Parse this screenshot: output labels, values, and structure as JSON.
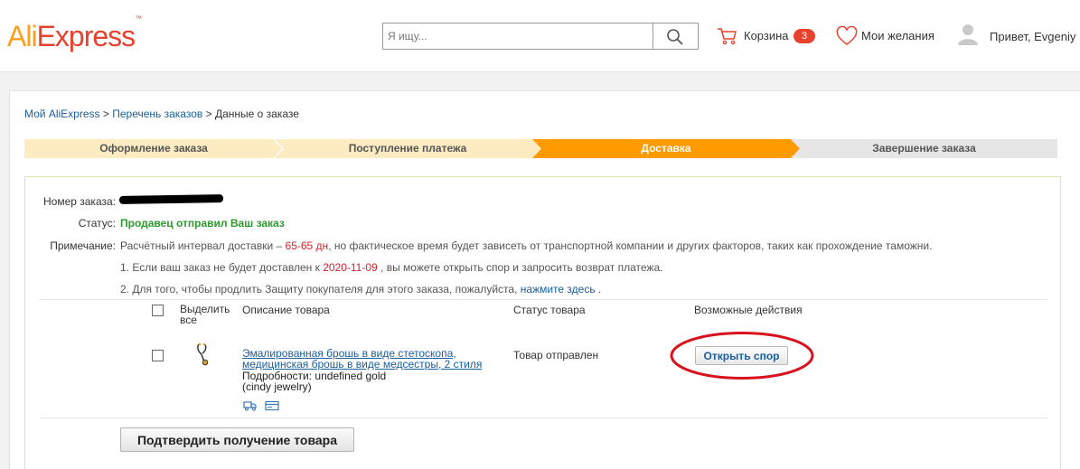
{
  "header": {
    "logo_part1": "Ali",
    "logo_part2": "Express",
    "logo_tm": "™",
    "search_placeholder": "Я ищу...",
    "search_icon": "search-icon",
    "cart_label": "Корзина",
    "cart_count": "3",
    "wishlist_label": "Мои желания",
    "greeting": "Привет, Evgeniy"
  },
  "breadcrumb": {
    "items": [
      "Мой AliExpress",
      "Перечень заказов",
      "Данные о заказе"
    ],
    "separator": ">"
  },
  "steps": [
    {
      "label": "Оформление заказа",
      "state": "done"
    },
    {
      "label": "Поступление платежа",
      "state": "done"
    },
    {
      "label": "Доставка",
      "state": "active"
    },
    {
      "label": "Завершение заказа",
      "state": "pending"
    }
  ],
  "colors": {
    "step_done": "#fdebc2",
    "step_active": "#ff9a00",
    "step_pending": "#e6e6e6",
    "status_green": "#2e9b2e",
    "accent_red": "#d0232b",
    "link_blue": "#1a5fa0",
    "annotation_red": "#d8121d"
  },
  "order": {
    "number_label": "Номер заказа:",
    "status_label": "Статус:",
    "status_value": "Продавец отправил Ваш заказ",
    "note_label": "Примечание:",
    "note_line1_before": "Расчётный интервал доставки – ",
    "note_line1_days": "65-65 дн",
    "note_line1_after": ", но фактическое время будет зависеть от транспортной компании и других факторов, таких как прохождение таможни.",
    "note_line2_before": "1. Если ваш заказ не будет доставлен к ",
    "note_line2_date": "2020-11-09",
    "note_line2_after": " , вы можете открыть спор и запросить возврат платежа.",
    "note_line3_before": "2. Для того, чтобы продлить Защиту покупателя для этого заказа, пожалуйста, ",
    "note_line3_link": "нажмите здесь",
    "note_line3_after": " ."
  },
  "table": {
    "col_select": "Выделить все",
    "col_select_line1": "Выделить",
    "col_select_line2": "все",
    "col_description": "Описание товара",
    "col_status": "Статус товара",
    "col_actions": "Возможные действия"
  },
  "product": {
    "title_line1": "Эмалированная брошь в виде стетоскопа,",
    "title_line2": "медицинская брошь в виде медсестры, 2 стиля",
    "details_line1": "Подробности: undefined gold",
    "details_line2": "(cindy jewelry)",
    "status": "Товар отправлен",
    "dispute_button": "Открыть спор",
    "icons": [
      "truck-icon",
      "card-icon"
    ]
  },
  "confirm_button": "Подтвердить получение товара"
}
